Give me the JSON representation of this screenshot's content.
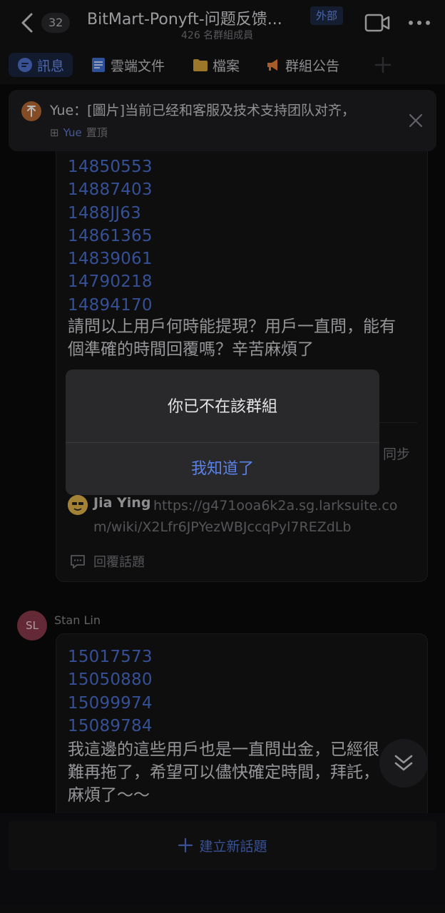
{
  "header": {
    "unread_count": "32",
    "title": "BitMart-Ponyft-问题反馈...",
    "external_tag": "外部",
    "member_count": "426 名群組成員"
  },
  "tabs": [
    {
      "label": "訊息",
      "icon": "message-icon",
      "active": true
    },
    {
      "label": "雲端文件",
      "icon": "cloud-doc-icon",
      "active": false
    },
    {
      "label": "檔案",
      "icon": "folder-icon",
      "active": false
    },
    {
      "label": "群組公告",
      "icon": "megaphone-icon",
      "active": false
    }
  ],
  "pinned": {
    "text": "Yue：[圖片]当前已经和客服及技术支持团队对齐，",
    "author": "Yue",
    "status": "置頂"
  },
  "message1": {
    "uids": [
      "14850553",
      "14887403",
      "1488JJ63",
      "14861365",
      "14839061",
      "14790218",
      "14894170"
    ],
    "text": "請問以上用戶何時能提現？用戶一直問，能有個準確的時間回覆嗎？辛苦麻煩了",
    "sync_label": "同步",
    "reply_name": "Jia Ying",
    "reply_link": "https://g471ooa6k2a.sg.larksuite.com/wiki/X2Lfr6JPYezWBJccqPyl7REZdLb",
    "reply_topic_label": "回覆話題"
  },
  "message2": {
    "avatar_initials": "SL",
    "sender": "Stan Lin",
    "uids": [
      "15017573",
      "15050880",
      "15099974",
      "15089784"
    ],
    "text": "我這邊的這些用戶也是一直問出金，已經很難再拖了，希望可以儘快確定時間，拜託，麻煩了～～"
  },
  "bottom": {
    "new_topic_label": "建立新話題"
  },
  "dialog": {
    "message": "你已不在該群組",
    "button_label": "我知道了"
  },
  "colors": {
    "accent": "#5a82e6",
    "background": "#0b0b0c",
    "card": "#141416",
    "link": "#4b6fcf"
  }
}
